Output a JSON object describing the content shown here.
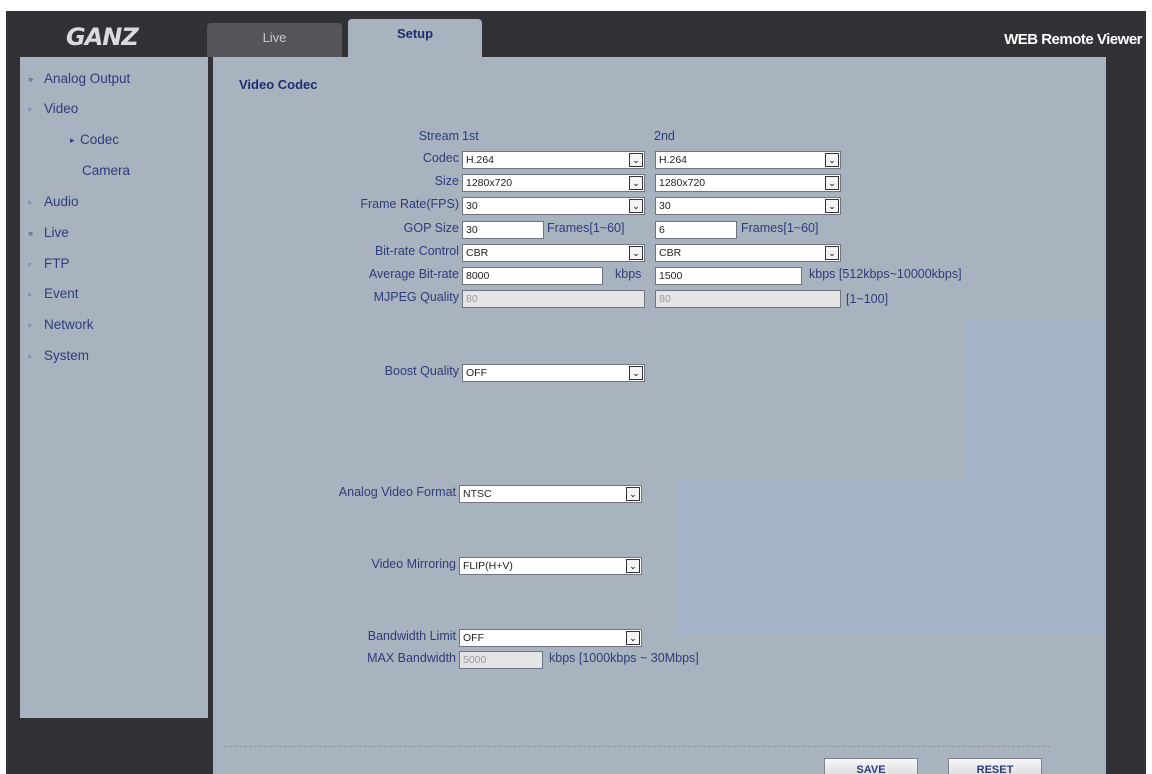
{
  "header": {
    "logo": "GANZ",
    "title": "WEB Remote Viewer",
    "tabs": [
      {
        "label": "Live"
      },
      {
        "label": "Setup"
      }
    ]
  },
  "sidebar": {
    "items": [
      {
        "label": "Analog Output",
        "marker": "»"
      },
      {
        "label": "Video",
        "marker": "▫"
      },
      {
        "label": "Codec",
        "marker": "▸"
      },
      {
        "label": "Camera",
        "marker": ""
      },
      {
        "label": "Audio",
        "marker": "▫"
      },
      {
        "label": "Live",
        "marker": "»"
      },
      {
        "label": "FTP",
        "marker": "▫"
      },
      {
        "label": "Event",
        "marker": "▫"
      },
      {
        "label": "Network",
        "marker": "▫"
      },
      {
        "label": "System",
        "marker": "▫"
      }
    ]
  },
  "main": {
    "section_title": "Video Codec",
    "stream": {
      "label": "Stream",
      "first": "1st",
      "second": "2nd"
    },
    "codec": {
      "label": "Codec",
      "first": "H.264",
      "second": "H.264"
    },
    "size": {
      "label": "Size",
      "first": "1280x720",
      "second": "1280x720"
    },
    "frame_rate": {
      "label": "Frame Rate(FPS)",
      "first": "30",
      "second": "30"
    },
    "gop": {
      "label": "GOP Size",
      "first": "30",
      "second": "6",
      "hint": "Frames[1~60]"
    },
    "bitrate_control": {
      "label": "Bit-rate Control",
      "first": "CBR",
      "second": "CBR"
    },
    "avg_bitrate": {
      "label": "Average Bit-rate",
      "first": "8000",
      "second": "1500",
      "unit": "kbps",
      "hint": "kbps [512kbps~10000kbps]"
    },
    "mjpeg": {
      "label": "MJPEG Quality",
      "first": "80",
      "second": "80",
      "hint": "[1~100]"
    },
    "boost": {
      "label": "Boost Quality",
      "value": "OFF"
    },
    "analog_format": {
      "label": "Analog Video Format",
      "value": "NTSC"
    },
    "mirroring": {
      "label": "Video Mirroring",
      "value": "FLIP(H+V)"
    },
    "bandwidth_limit": {
      "label": "Bandwidth Limit",
      "value": "OFF"
    },
    "max_bandwidth": {
      "label": "MAX Bandwidth",
      "value": "5000",
      "hint": "kbps [1000kbps ~ 30Mbps]"
    },
    "arrow_glyph": "⌄"
  },
  "buttons": {
    "save": "SAVE",
    "reset": "RESET"
  },
  "colors": {
    "frame": "#313236",
    "panel": "#a9b3bf",
    "text": "#2c3d7a"
  }
}
